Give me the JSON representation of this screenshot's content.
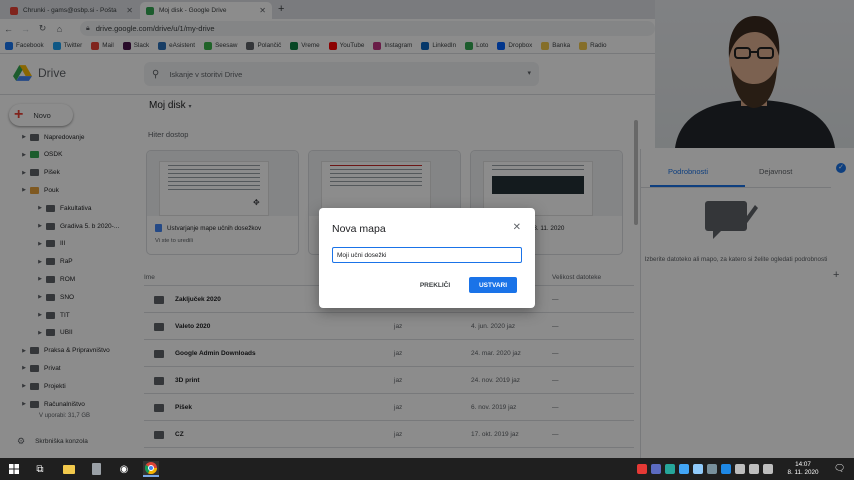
{
  "browser": {
    "tabs": [
      {
        "title": "Chrunki - gams@osbp.si - Pošta",
        "fav_color": "#ea4335",
        "active": false
      },
      {
        "title": "Moj disk - Google Drive",
        "fav_color": "#34a853",
        "active": true
      }
    ],
    "url": "drive.google.com/drive/u/1/my-drive",
    "bookmarks": [
      {
        "label": "Facebook",
        "color": "#1877f2"
      },
      {
        "label": "Twitter",
        "color": "#1da1f2"
      },
      {
        "label": "Mail",
        "color": "#ea4335"
      },
      {
        "label": "Slack",
        "color": "#4a154b"
      },
      {
        "label": "eAsistent",
        "color": "#2a6fb8"
      },
      {
        "label": "Seesaw",
        "color": "#3bb54a"
      },
      {
        "label": "Polančič",
        "color": "#5f6368"
      },
      {
        "label": "Vreme",
        "color": "#0b8043"
      },
      {
        "label": "YouTube",
        "color": "#ff0000"
      },
      {
        "label": "Instagram",
        "color": "#c13584"
      },
      {
        "label": "LinkedIn",
        "color": "#0a66c2"
      },
      {
        "label": "Loto",
        "color": "#34a853"
      },
      {
        "label": "Dropbox",
        "color": "#0061ff"
      },
      {
        "label": "Banka",
        "color": "#f2c94c"
      },
      {
        "label": "Radio",
        "color": "#f2c94c"
      }
    ]
  },
  "drive": {
    "logo_text": "Drive",
    "search_placeholder": "Iskanje v storitvi Drive",
    "new_label": "Novo",
    "tree": [
      {
        "label": "Napredovanje",
        "indent": 1,
        "color": ""
      },
      {
        "label": "OSDK",
        "indent": 1,
        "color": "green"
      },
      {
        "label": "Pišek",
        "indent": 1,
        "color": ""
      },
      {
        "label": "Pouk",
        "indent": 1,
        "color": "orange"
      },
      {
        "label": "Fakultativa",
        "indent": 2,
        "color": ""
      },
      {
        "label": "Gradiva 5. b 2020-...",
        "indent": 2,
        "color": ""
      },
      {
        "label": "III",
        "indent": 2,
        "color": ""
      },
      {
        "label": "RaP",
        "indent": 2,
        "color": ""
      },
      {
        "label": "ROM",
        "indent": 2,
        "color": ""
      },
      {
        "label": "SNO",
        "indent": 2,
        "color": ""
      },
      {
        "label": "TIT",
        "indent": 2,
        "color": ""
      },
      {
        "label": "UBII",
        "indent": 2,
        "color": ""
      },
      {
        "label": "Praksa & Pripravništvo",
        "indent": 1,
        "color": ""
      },
      {
        "label": "Privat",
        "indent": 1,
        "color": ""
      },
      {
        "label": "Projekti",
        "indent": 1,
        "color": ""
      },
      {
        "label": "Računalništvo",
        "indent": 1,
        "color": ""
      }
    ],
    "storage": "V uporabi: 31,7 GB",
    "console_label": "Skrbniška konzola",
    "main_title": "Moj disk",
    "quick_access_label": "Hiter dostop",
    "quick_cards": [
      {
        "title": "Ustvarjanje mape učnih dosežkov",
        "sub": "Vi ste to uredili"
      },
      {
        "title": "",
        "sub": ""
      },
      {
        "title": "...4. teden 9. -13. 11. 2020",
        "sub": ""
      }
    ],
    "list_headers": {
      "name": "Ime",
      "size": "Velikost datoteke"
    },
    "rows": [
      {
        "name": "Zaključek 2020",
        "owner": "",
        "date": "",
        "size": "—"
      },
      {
        "name": "Valeto 2020",
        "owner": "jaz",
        "date": "4. jun. 2020 jaz",
        "size": "—"
      },
      {
        "name": "Google Admin Downloads",
        "owner": "jaz",
        "date": "24. mar. 2020 jaz",
        "size": "—"
      },
      {
        "name": "3D print",
        "owner": "jaz",
        "date": "24. nov. 2019 jaz",
        "size": "—"
      },
      {
        "name": "Pišek",
        "owner": "jaz",
        "date": "6. nov. 2019 jaz",
        "size": "—"
      },
      {
        "name": "CZ",
        "owner": "jaz",
        "date": "17. okt. 2019 jaz",
        "size": "—"
      }
    ],
    "details": {
      "tab_details": "Podrobnosti",
      "tab_activity": "Dejavnost",
      "empty_text": "Izberite datoteko ali mapo, za katero si želite ogledati podrobnosti"
    }
  },
  "dialog": {
    "title": "Nova mapa",
    "input_value": "Moji učni dosežki",
    "cancel_label": "PREKLIČI",
    "create_label": "USTVARI"
  },
  "taskbar": {
    "time": "14:07",
    "date": "8. 11. 2020"
  }
}
